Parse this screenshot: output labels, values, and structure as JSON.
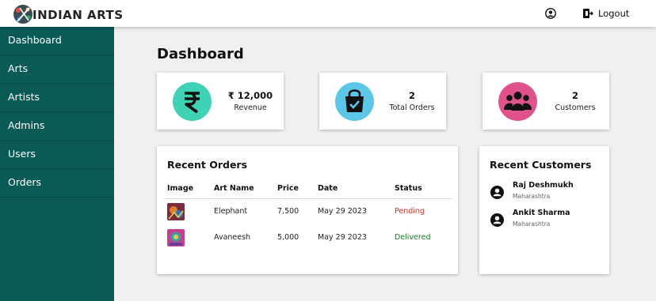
{
  "header": {
    "brand": "INDIAN ARTS",
    "logout_label": "Logout"
  },
  "sidebar": {
    "items": [
      {
        "label": "Dashboard"
      },
      {
        "label": "Arts"
      },
      {
        "label": "Artists"
      },
      {
        "label": "Admins"
      },
      {
        "label": "Users"
      },
      {
        "label": "Orders"
      }
    ]
  },
  "main": {
    "title": "Dashboard"
  },
  "stats": [
    {
      "value": "₹ 12,000",
      "label": "Revenue",
      "icon": "rupee-icon",
      "color": "#3fd2b4"
    },
    {
      "value": "2",
      "label": "Total Orders",
      "icon": "shopping-bag-icon",
      "color": "#5bc6e6"
    },
    {
      "value": "2",
      "label": "Customers",
      "icon": "users-icon",
      "color": "#e0528c"
    }
  ],
  "recent_orders": {
    "title": "Recent Orders",
    "columns": [
      "Image",
      "Art Name",
      "Price",
      "Date",
      "Status"
    ],
    "rows": [
      {
        "art_name": "Elephant",
        "price": "7,500",
        "date": "May 29 2023",
        "status": "Pending"
      },
      {
        "art_name": "Avaneesh",
        "price": "5,000",
        "date": "May 29 2023",
        "status": "Delivered"
      }
    ]
  },
  "recent_customers": {
    "title": "Recent Customers",
    "items": [
      {
        "name": "Raj Deshmukh",
        "state": "Maharashtra"
      },
      {
        "name": "Ankit Sharma",
        "state": "Maharashtra"
      }
    ]
  }
}
